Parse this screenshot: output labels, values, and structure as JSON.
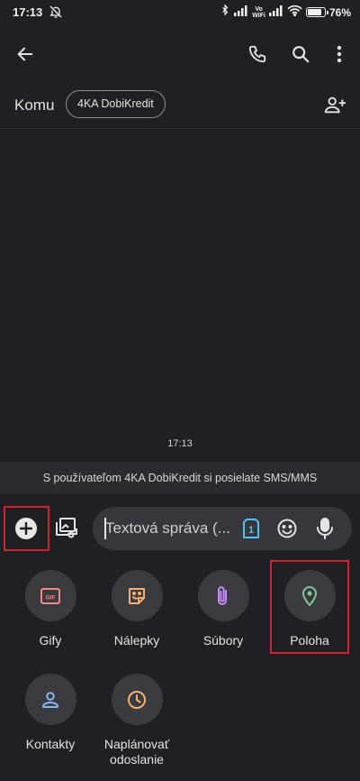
{
  "status_bar": {
    "time": "17:13",
    "volte_line1": "Vo",
    "volte_line2": "WiFi",
    "battery_percent": "76%",
    "battery_level": 0.76
  },
  "app_bar": {
    "back_icon": "arrow-back-icon",
    "call_icon": "phone-icon",
    "search_icon": "search-icon",
    "more_icon": "more-vert-icon"
  },
  "recipient": {
    "label": "Komu",
    "chip": "4KA DobiKredit",
    "add_icon": "person-add-icon"
  },
  "conversation": {
    "timestamp": "17:13",
    "info": "S používateľom 4KA DobiKredit si posielate SMS/MMS"
  },
  "compose": {
    "placeholder": "Textová správa (...",
    "sim_number": "1"
  },
  "attachments": [
    {
      "label": "Gify",
      "icon": "gif-icon",
      "color": "#f28b82",
      "badge": "GIF"
    },
    {
      "label": "Nálepky",
      "icon": "sticker-icon",
      "color": "#fcad70"
    },
    {
      "label": "Súbory",
      "icon": "paperclip-icon",
      "color": "#c58af9"
    },
    {
      "label": "Poloha",
      "icon": "location-pin-icon",
      "color": "#81c995"
    },
    {
      "label": "Kontakty",
      "icon": "contact-icon",
      "color": "#8ab4f8"
    },
    {
      "label": "Naplánovať odoslanie",
      "icon": "clock-icon",
      "color": "#fcad70"
    }
  ],
  "colors": {
    "background": "#1f2024",
    "highlight": "#d6202e",
    "sim_accent": "#4fc3f7"
  }
}
